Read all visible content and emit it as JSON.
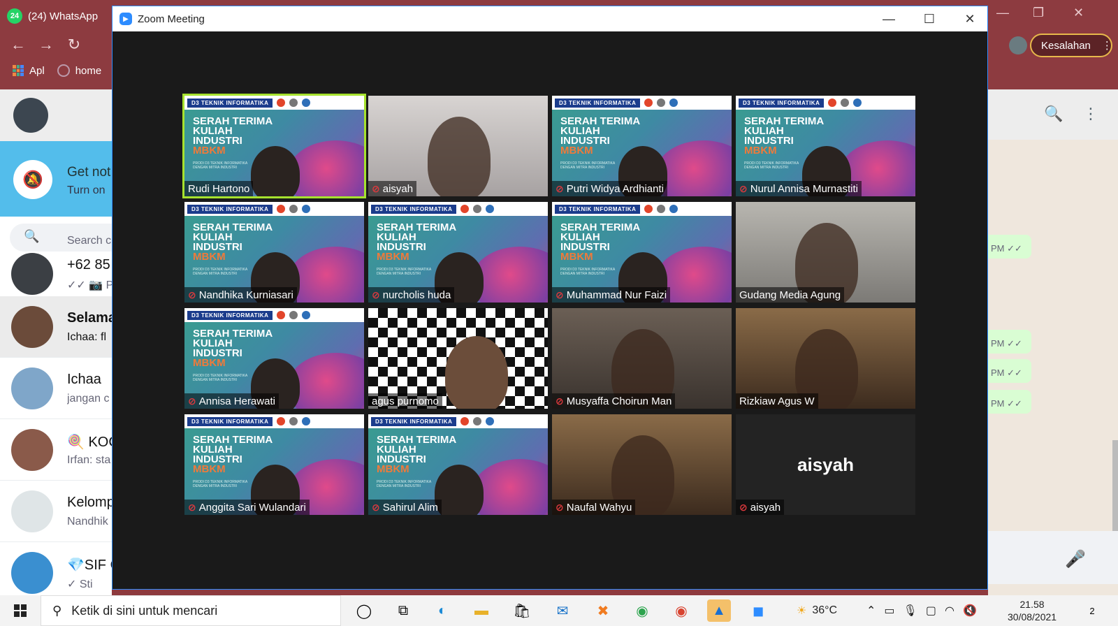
{
  "browser": {
    "tab_title": "(24) WhatsApp",
    "tab_badge": "24",
    "bookmarks": [
      "Apl",
      "home"
    ],
    "error_button": "Kesalahan"
  },
  "whatsapp": {
    "notification_title": "Get not",
    "notification_sub": "Turn on",
    "search_placeholder": "Search c",
    "chats": [
      {
        "name": "+62 85",
        "msg": "✓✓ 📷 Ph"
      },
      {
        "name": "Selama",
        "msg": "Ichaa: fl"
      },
      {
        "name": "Ichaa",
        "msg": "jangan c"
      },
      {
        "name": "🍭 KOC",
        "msg": "Irfan: sta"
      },
      {
        "name": "Kelomp",
        "msg": "Nandhik"
      },
      {
        "name": "💎SIF C",
        "msg": "✓ Sti"
      }
    ],
    "bubbles": [
      "PM ✓✓",
      "PM ✓✓",
      "PM ✓✓",
      "PM ✓✓"
    ]
  },
  "zoom": {
    "window_title": "Zoom Meeting",
    "slide": {
      "header": "D3 TEKNIK INFORMATIKA",
      "line1": "SERAH TERIMA",
      "line2": "KULIAH",
      "line3": "INDUSTRI",
      "line4": "MBKM",
      "small": "PRODI D3 TEKNIK INFORMATIKA DENGAN MITRA INDUSTRI"
    },
    "participants": [
      {
        "name": "Rudi Hartono",
        "muted": false
      },
      {
        "name": "aisyah",
        "muted": true
      },
      {
        "name": "Putri Widya Ardhianti",
        "muted": true
      },
      {
        "name": "Nurul Annisa Murnastiti",
        "muted": true
      },
      {
        "name": "Nandhika Kurniasari",
        "muted": true
      },
      {
        "name": "nurcholis huda",
        "muted": true
      },
      {
        "name": "Muhammad Nur Faizi",
        "muted": true
      },
      {
        "name": "Gudang Media Agung",
        "muted": false
      },
      {
        "name": "Annisa Herawati",
        "muted": true
      },
      {
        "name": "agus purnomo",
        "muted": false
      },
      {
        "name": "Musyaffa Choirun Man",
        "muted": true
      },
      {
        "name": "Rizkiaw Agus W",
        "muted": false
      },
      {
        "name": "Anggita Sari Wulandari",
        "muted": true
      },
      {
        "name": "Sahirul Alim",
        "muted": true
      },
      {
        "name": "Naufal Wahyu",
        "muted": true
      },
      {
        "name": "aisyah",
        "muted": true,
        "no_video_label": "aisyah"
      }
    ]
  },
  "taskbar": {
    "search_placeholder": "Ketik di sini untuk mencari",
    "weather": "36°C",
    "time": "21.58",
    "date": "30/08/2021",
    "notif_count": "2"
  }
}
